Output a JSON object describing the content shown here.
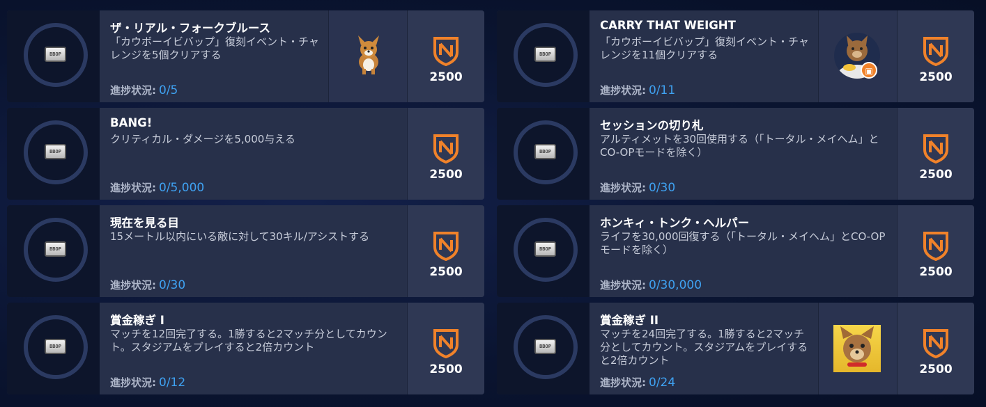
{
  "progress_label": "進捗状況:",
  "ticket_text": "BBOP",
  "colors": {
    "accent_orange": "#f0822a",
    "progress_blue": "#3fa2f2"
  },
  "challenges": [
    {
      "title": "ザ・リアル・フォークブルース",
      "description": "「カウボーイビバップ」復刻イベント・チャレンジを5個クリアする",
      "progress": "0/5",
      "reward": "2500",
      "reward_icon": "shield-emblem-icon",
      "thumbnail": "spray"
    },
    {
      "title": "CARRY THAT WEIGHT",
      "description": "「カウボーイビバップ」復刻イベント・チャレンジを11個クリアする",
      "progress": "0/11",
      "reward": "2500",
      "reward_icon": "shield-emblem-icon",
      "thumbnail": "icon"
    },
    {
      "title": "BANG!",
      "description": "クリティカル・ダメージを5,000与える",
      "progress": "0/5,000",
      "reward": "2500",
      "reward_icon": "shield-emblem-icon"
    },
    {
      "title": "セッションの切り札",
      "description": "アルティメットを30回使用する（「トータル・メイヘム」とCO-OPモードを除く）",
      "progress": "0/30",
      "reward": "2500",
      "reward_icon": "shield-emblem-icon"
    },
    {
      "title": "現在を見る目",
      "description": "15メートル以内にいる敵に対して30キル/アシストする",
      "progress": "0/30",
      "reward": "2500",
      "reward_icon": "shield-emblem-icon"
    },
    {
      "title": "ホンキィ・トンク・ヘルパー",
      "description": "ライフを30,000回復する（「トータル・メイヘム」とCO-OPモードを除く）",
      "progress": "0/30,000",
      "reward": "2500",
      "reward_icon": "shield-emblem-icon"
    },
    {
      "title": "賞金稼ぎ I",
      "description": "マッチを12回完了する。1勝すると2マッチ分としてカウント。スタジアムをプレイすると2倍カウント",
      "progress": "0/12",
      "reward": "2500",
      "reward_icon": "shield-emblem-icon"
    },
    {
      "title": "賞金稼ぎ II",
      "description": "マッチを24回完了する。1勝すると2マッチ分としてカウント。スタジアムをプレイすると2倍カウント",
      "progress": "0/24",
      "reward": "2500",
      "reward_icon": "shield-emblem-icon",
      "thumbnail": "player-card"
    }
  ]
}
